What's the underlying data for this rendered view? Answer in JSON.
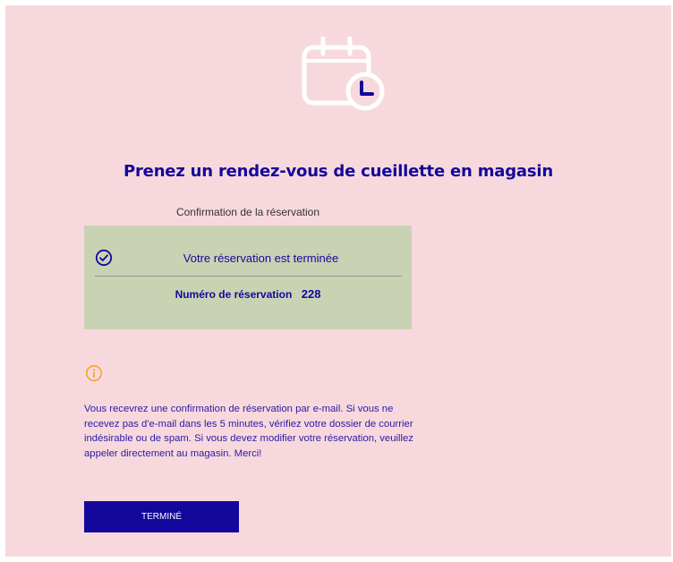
{
  "header": {
    "icon": "calendar-clock-icon",
    "title": "Prenez un rendez-vous de cueillette en magasin"
  },
  "step": {
    "label": "Confirmation de la réservation"
  },
  "confirmation": {
    "icon": "check-circle-icon",
    "message": "Votre réservation est terminée",
    "reservation_label": "Numéro de réservation",
    "reservation_number": "228",
    "background_color": "#c9d3b4"
  },
  "notice": {
    "icon": "info-circle-icon",
    "icon_color": "#f5a623",
    "text": "Vous recevrez une confirmation de réservation par e-mail. Si vous ne recevez pas d'e-mail dans les 5 minutes, vérifiez votre dossier de courrier indésirable ou de spam. Si vous devez modifier votre réservation, veuillez appeler directement au magasin. Merci!"
  },
  "actions": {
    "done_label": "Terminé"
  },
  "colors": {
    "page_background": "#f7d9dd",
    "accent": "#14079b"
  }
}
